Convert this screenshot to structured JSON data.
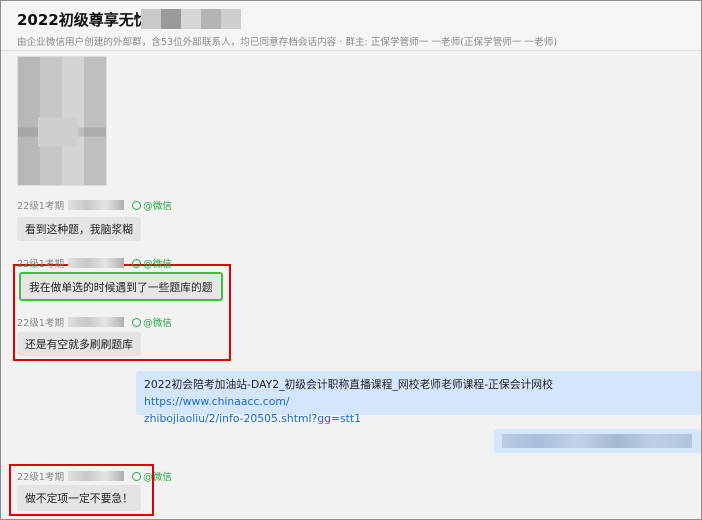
{
  "header": {
    "title": "2022初级尊享无忧",
    "subtitle": "由企业微信用户创建的外部群，含53位外部联系人，均已同意存档会话内容 · 群主: 正保学管师一 一老师(正保学管师一 一老师)"
  },
  "messages": [
    {
      "sender": "22级1考期",
      "tag": "@微信",
      "text": "看到这种题，我脑浆糊"
    },
    {
      "sender": "22级1考期",
      "tag": "@微信",
      "text": "我在做单选的时候遇到了一些题库的题"
    },
    {
      "sender": "22级1考期",
      "tag": "@微信",
      "text": "还是有空就多刷刷题库"
    },
    {
      "sender": "22级1考期",
      "tag": "@微信",
      "text": "做不定项一定不要急！"
    }
  ],
  "outgoing": {
    "text": "2022初会陪考加油站-DAY2_初级会计职称直播课程_网校老师老师课程-正保会计网校",
    "link_part1": "https://www.chinaacc.com/",
    "link_part2": "zhibojiaoliu/2/info-20505.shtml?gg=stt1"
  },
  "colors": {
    "highlight_red": "#e00000",
    "highlight_green": "#3cc33c",
    "outgoing_bubble": "#d3e6fb",
    "incoming_bubble": "#e4e4e4",
    "wechat_tag": "#2aa54a",
    "link": "#1a6cc7"
  }
}
